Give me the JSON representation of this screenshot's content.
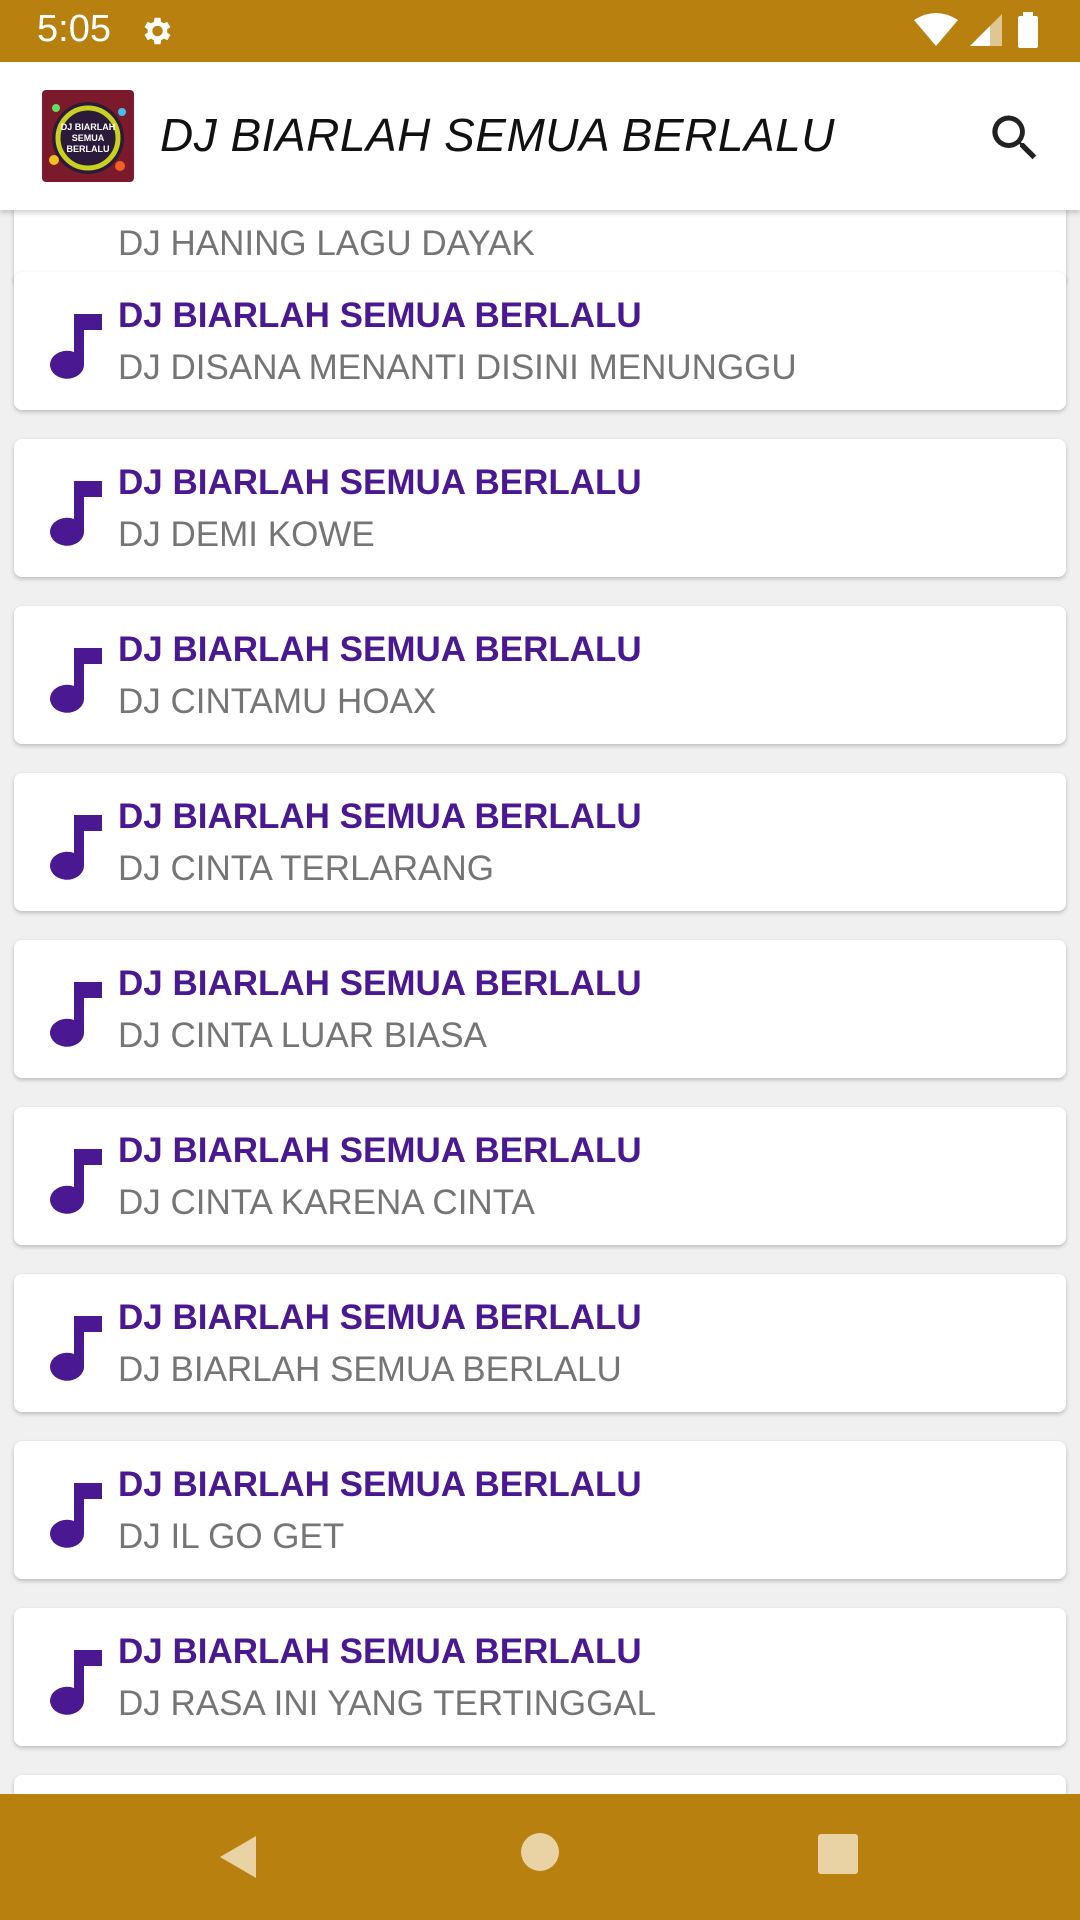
{
  "status_bar": {
    "time": "5:05",
    "icons": [
      "gear-icon",
      "wifi-icon",
      "signal-icon",
      "battery-icon"
    ],
    "color": "#b8800e"
  },
  "app_bar": {
    "title": "DJ BIARLAH SEMUA BERLALU",
    "logo_text": [
      "DJ BIARLAH",
      "SEMUA",
      "BERLALU"
    ],
    "search_icon": "search-icon"
  },
  "list": {
    "partial_item_subtitle": "DJ HANING LAGU DAYAK",
    "items": [
      {
        "title": "DJ BIARLAH SEMUA BERLALU",
        "subtitle": "DJ DISANA MENANTI DISINI MENUNGGU"
      },
      {
        "title": "DJ BIARLAH SEMUA BERLALU",
        "subtitle": "DJ DEMI KOWE"
      },
      {
        "title": "DJ BIARLAH SEMUA BERLALU",
        "subtitle": "DJ CINTAMU HOAX"
      },
      {
        "title": "DJ BIARLAH SEMUA BERLALU",
        "subtitle": "DJ CINTA TERLARANG"
      },
      {
        "title": "DJ BIARLAH SEMUA BERLALU",
        "subtitle": "DJ CINTA LUAR BIASA"
      },
      {
        "title": "DJ BIARLAH SEMUA BERLALU",
        "subtitle": "DJ CINTA KARENA CINTA"
      },
      {
        "title": "DJ BIARLAH SEMUA BERLALU",
        "subtitle": "DJ BIARLAH SEMUA BERLALU"
      },
      {
        "title": "DJ BIARLAH SEMUA BERLALU",
        "subtitle": "DJ IL GO GET"
      },
      {
        "title": "DJ BIARLAH SEMUA BERLALU",
        "subtitle": "DJ RASA INI YANG TERTINGGAL"
      }
    ],
    "item_icon": "music-note-icon",
    "title_color": "#4a1890"
  },
  "nav_bar": {
    "icons": [
      "back-icon",
      "home-icon",
      "recents-icon"
    ],
    "color": "#b8800e"
  }
}
